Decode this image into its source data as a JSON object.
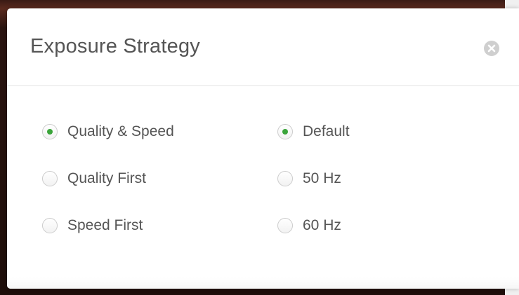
{
  "dialog": {
    "title": "Exposure Strategy",
    "close_icon": "close-circle-icon"
  },
  "strategy_group": {
    "options": [
      {
        "label": "Quality & Speed",
        "checked": true
      },
      {
        "label": "Quality First",
        "checked": false
      },
      {
        "label": "Speed First",
        "checked": false
      }
    ]
  },
  "frequency_group": {
    "options": [
      {
        "label": "Default",
        "checked": true
      },
      {
        "label": "50 Hz",
        "checked": false
      },
      {
        "label": "60 Hz",
        "checked": false
      }
    ]
  },
  "colors": {
    "accent": "#3aa43a",
    "text": "#555555"
  }
}
